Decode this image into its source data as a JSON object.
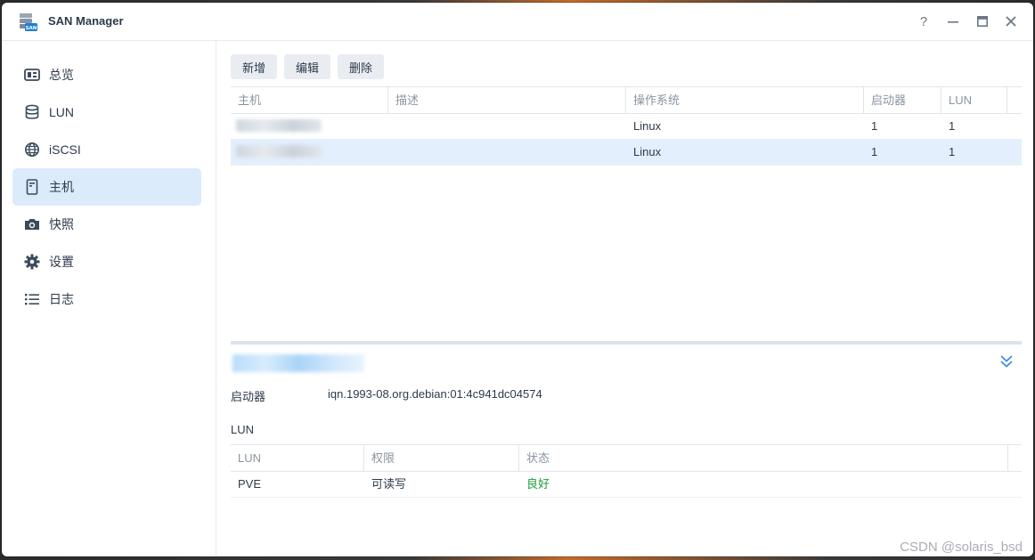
{
  "window": {
    "title": "SAN Manager",
    "controls": [
      "?",
      "minimize",
      "maximize",
      "close"
    ]
  },
  "sidebar": {
    "items": [
      {
        "label": "总览",
        "icon": "overview-icon"
      },
      {
        "label": "LUN",
        "icon": "database-icon"
      },
      {
        "label": "iSCSI",
        "icon": "globe-icon"
      },
      {
        "label": "主机",
        "icon": "host-icon",
        "active": true
      },
      {
        "label": "快照",
        "icon": "camera-icon"
      },
      {
        "label": "设置",
        "icon": "gear-icon"
      },
      {
        "label": "日志",
        "icon": "list-icon"
      }
    ]
  },
  "toolbar": {
    "add_label": "新增",
    "edit_label": "编辑",
    "delete_label": "删除"
  },
  "hosts_table": {
    "columns": [
      "主机",
      "描述",
      "操作系统",
      "启动器",
      "LUN"
    ],
    "rows": [
      {
        "host": "",
        "description": "",
        "os": "Linux",
        "initiators": "1",
        "lun": "1",
        "selected": false
      },
      {
        "host": "",
        "description": "",
        "os": "Linux",
        "initiators": "1",
        "lun": "1",
        "selected": true
      }
    ]
  },
  "detail": {
    "initiator_label": "启动器",
    "initiator_value": "iqn.1993-08.org.debian:01:4c941dc04574",
    "lun_section_title": "LUN",
    "lun_columns": [
      "LUN",
      "权限",
      "状态"
    ],
    "lun_rows": [
      {
        "lun": "PVE",
        "permission": "可读写",
        "status": "良好"
      }
    ]
  },
  "watermark": "CSDN @solaris_bsd",
  "colors": {
    "accent": "#dcebfb",
    "selected_row": "#e3effc",
    "status_good": "#1f9a3a"
  }
}
